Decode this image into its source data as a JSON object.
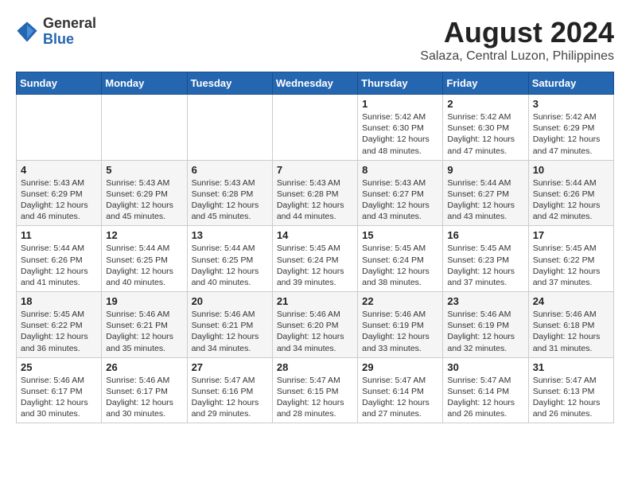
{
  "logo": {
    "general": "General",
    "blue": "Blue"
  },
  "title": "August 2024",
  "location": "Salaza, Central Luzon, Philippines",
  "weekdays": [
    "Sunday",
    "Monday",
    "Tuesday",
    "Wednesday",
    "Thursday",
    "Friday",
    "Saturday"
  ],
  "weeks": [
    [
      {
        "day": "",
        "info": ""
      },
      {
        "day": "",
        "info": ""
      },
      {
        "day": "",
        "info": ""
      },
      {
        "day": "",
        "info": ""
      },
      {
        "day": "1",
        "info": "Sunrise: 5:42 AM\nSunset: 6:30 PM\nDaylight: 12 hours\nand 48 minutes."
      },
      {
        "day": "2",
        "info": "Sunrise: 5:42 AM\nSunset: 6:30 PM\nDaylight: 12 hours\nand 47 minutes."
      },
      {
        "day": "3",
        "info": "Sunrise: 5:42 AM\nSunset: 6:29 PM\nDaylight: 12 hours\nand 47 minutes."
      }
    ],
    [
      {
        "day": "4",
        "info": "Sunrise: 5:43 AM\nSunset: 6:29 PM\nDaylight: 12 hours\nand 46 minutes."
      },
      {
        "day": "5",
        "info": "Sunrise: 5:43 AM\nSunset: 6:29 PM\nDaylight: 12 hours\nand 45 minutes."
      },
      {
        "day": "6",
        "info": "Sunrise: 5:43 AM\nSunset: 6:28 PM\nDaylight: 12 hours\nand 45 minutes."
      },
      {
        "day": "7",
        "info": "Sunrise: 5:43 AM\nSunset: 6:28 PM\nDaylight: 12 hours\nand 44 minutes."
      },
      {
        "day": "8",
        "info": "Sunrise: 5:43 AM\nSunset: 6:27 PM\nDaylight: 12 hours\nand 43 minutes."
      },
      {
        "day": "9",
        "info": "Sunrise: 5:44 AM\nSunset: 6:27 PM\nDaylight: 12 hours\nand 43 minutes."
      },
      {
        "day": "10",
        "info": "Sunrise: 5:44 AM\nSunset: 6:26 PM\nDaylight: 12 hours\nand 42 minutes."
      }
    ],
    [
      {
        "day": "11",
        "info": "Sunrise: 5:44 AM\nSunset: 6:26 PM\nDaylight: 12 hours\nand 41 minutes."
      },
      {
        "day": "12",
        "info": "Sunrise: 5:44 AM\nSunset: 6:25 PM\nDaylight: 12 hours\nand 40 minutes."
      },
      {
        "day": "13",
        "info": "Sunrise: 5:44 AM\nSunset: 6:25 PM\nDaylight: 12 hours\nand 40 minutes."
      },
      {
        "day": "14",
        "info": "Sunrise: 5:45 AM\nSunset: 6:24 PM\nDaylight: 12 hours\nand 39 minutes."
      },
      {
        "day": "15",
        "info": "Sunrise: 5:45 AM\nSunset: 6:24 PM\nDaylight: 12 hours\nand 38 minutes."
      },
      {
        "day": "16",
        "info": "Sunrise: 5:45 AM\nSunset: 6:23 PM\nDaylight: 12 hours\nand 37 minutes."
      },
      {
        "day": "17",
        "info": "Sunrise: 5:45 AM\nSunset: 6:22 PM\nDaylight: 12 hours\nand 37 minutes."
      }
    ],
    [
      {
        "day": "18",
        "info": "Sunrise: 5:45 AM\nSunset: 6:22 PM\nDaylight: 12 hours\nand 36 minutes."
      },
      {
        "day": "19",
        "info": "Sunrise: 5:46 AM\nSunset: 6:21 PM\nDaylight: 12 hours\nand 35 minutes."
      },
      {
        "day": "20",
        "info": "Sunrise: 5:46 AM\nSunset: 6:21 PM\nDaylight: 12 hours\nand 34 minutes."
      },
      {
        "day": "21",
        "info": "Sunrise: 5:46 AM\nSunset: 6:20 PM\nDaylight: 12 hours\nand 34 minutes."
      },
      {
        "day": "22",
        "info": "Sunrise: 5:46 AM\nSunset: 6:19 PM\nDaylight: 12 hours\nand 33 minutes."
      },
      {
        "day": "23",
        "info": "Sunrise: 5:46 AM\nSunset: 6:19 PM\nDaylight: 12 hours\nand 32 minutes."
      },
      {
        "day": "24",
        "info": "Sunrise: 5:46 AM\nSunset: 6:18 PM\nDaylight: 12 hours\nand 31 minutes."
      }
    ],
    [
      {
        "day": "25",
        "info": "Sunrise: 5:46 AM\nSunset: 6:17 PM\nDaylight: 12 hours\nand 30 minutes."
      },
      {
        "day": "26",
        "info": "Sunrise: 5:46 AM\nSunset: 6:17 PM\nDaylight: 12 hours\nand 30 minutes."
      },
      {
        "day": "27",
        "info": "Sunrise: 5:47 AM\nSunset: 6:16 PM\nDaylight: 12 hours\nand 29 minutes."
      },
      {
        "day": "28",
        "info": "Sunrise: 5:47 AM\nSunset: 6:15 PM\nDaylight: 12 hours\nand 28 minutes."
      },
      {
        "day": "29",
        "info": "Sunrise: 5:47 AM\nSunset: 6:14 PM\nDaylight: 12 hours\nand 27 minutes."
      },
      {
        "day": "30",
        "info": "Sunrise: 5:47 AM\nSunset: 6:14 PM\nDaylight: 12 hours\nand 26 minutes."
      },
      {
        "day": "31",
        "info": "Sunrise: 5:47 AM\nSunset: 6:13 PM\nDaylight: 12 hours\nand 26 minutes."
      }
    ]
  ]
}
